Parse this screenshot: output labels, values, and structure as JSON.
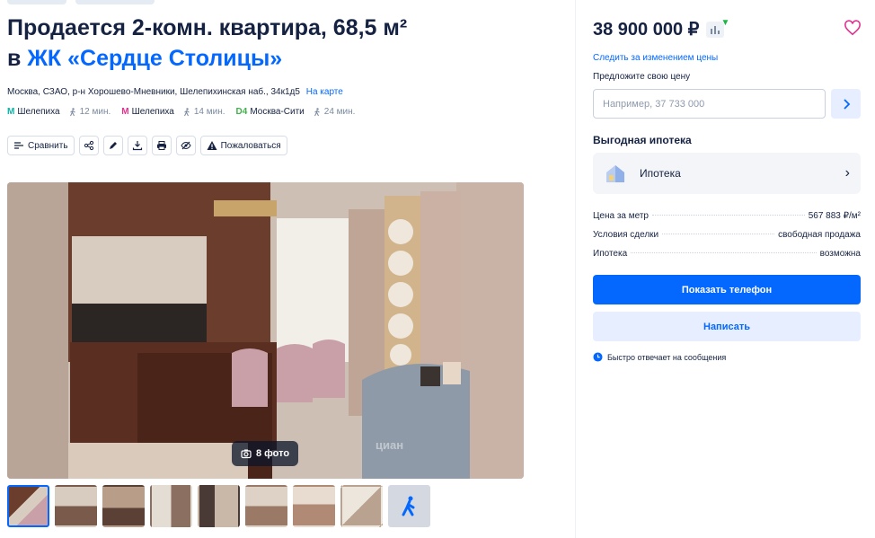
{
  "listing": {
    "title_line1": "Продается 2-комн. квартира, 68,5 м²",
    "title_prefix": "в",
    "complex_name": "ЖК «Сердце Столицы»",
    "address": "Москва, СЗАО, р-н Хорошево-Мневники, Шелепихинская наб., 34к1д5",
    "map_link": "На карте",
    "metros": [
      {
        "name": "Шелепиха",
        "line_mark": "M",
        "color": "#0bb3a6",
        "walk": "12 мин."
      },
      {
        "name": "Шелепиха",
        "line_mark": "M",
        "color": "#e0338f",
        "walk": "14 мин."
      },
      {
        "name": "Москва-Сити",
        "line_mark": "D4",
        "color": "#40b14b",
        "walk": "24 мин."
      }
    ]
  },
  "toolbar": {
    "compare_label": "Сравнить",
    "report_label": "Пожаловаться"
  },
  "gallery": {
    "photo_count_label": "8 фото",
    "watermark": "циан"
  },
  "sidebar": {
    "price": "38 900 000 ₽",
    "track_price_link": "Следить за изменением цены",
    "offer_label": "Предложите свою цену",
    "offer_placeholder": "Например, 37 733 000",
    "mortgage_title": "Выгодная ипотека",
    "mortgage_card_label": "Ипотека",
    "facts": [
      {
        "label": "Цена за метр",
        "value": "567 883 ₽/м²"
      },
      {
        "label": "Условия сделки",
        "value": "свободная продажа"
      },
      {
        "label": "Ипотека",
        "value": "возможна"
      }
    ],
    "show_phone_label": "Показать телефон",
    "write_label": "Написать",
    "fast_reply_note": "Быстро отвечает на сообщения"
  },
  "colors": {
    "accent": "#0468ff",
    "heart": "#e0338f"
  }
}
